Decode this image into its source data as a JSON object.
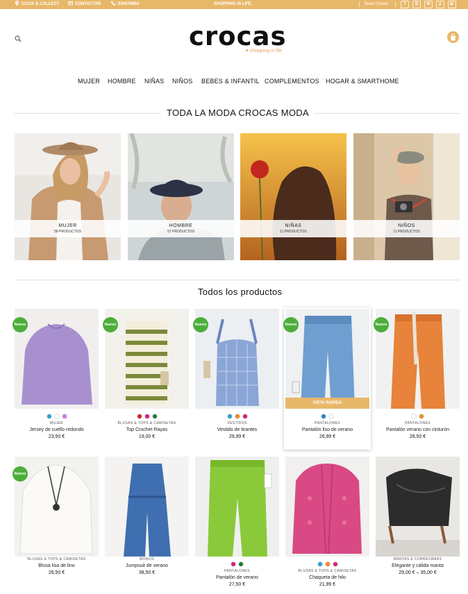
{
  "topbar": {
    "click_collect": "CLICK & COLLECT",
    "contact": "CONTACTAR",
    "phone": "920076894",
    "slogan": "SHOPPING IS LIFE.",
    "team": "Team Crocas"
  },
  "brand": {
    "name": "crocas",
    "tagline": "shopping is life",
    "accent": "#e8b86a"
  },
  "nav": [
    "MUJER",
    "HOMBRE",
    "NIÑAS",
    "NIÑOS",
    "BEBES & INFANTIL",
    "COMPLEMENTOS",
    "HOGAR & SMARTHOME"
  ],
  "categories_title": "TODA LA MODA CROCAS MODA",
  "categories": [
    {
      "name": "MUJER",
      "count": "58 PRODUCTOS"
    },
    {
      "name": "HOMBRE",
      "count": "57 PRODUCTOS"
    },
    {
      "name": "NIÑAS",
      "count": "11 PRODUCTOS"
    },
    {
      "name": "NIÑOS",
      "count": "11 PRODUCTOS"
    }
  ],
  "products_title": "Todos los productos",
  "badge_label": "Nuevo",
  "quick_view_label": "VISTA RÁPIDA",
  "products": [
    {
      "category": "MUJER",
      "name": "Jersey de cuello redondo",
      "price": "23,50 €",
      "is_new": true,
      "swatches": [
        "#2aa3d8",
        "#ffffff",
        "#c77fe0"
      ]
    },
    {
      "category": "BLUSAS & TOPS & CAMISETAS",
      "name": "Top Crochet Rayas",
      "price": "19,00 €",
      "is_new": true,
      "swatches": [
        "#d81f26",
        "#e0187b",
        "#1e7a2a"
      ]
    },
    {
      "category": "VESTIDOS",
      "name": "Vestido de tirantes",
      "price": "29,99 €",
      "is_new": true,
      "swatches": [
        "#2aa3d8",
        "#f08a1c",
        "#e0187b"
      ]
    },
    {
      "category": "PANTALONES",
      "name": "Pantalón liso de verano",
      "price": "26,99 €",
      "is_new": true,
      "swatches": [
        "#2a7fd8",
        "#ffffff"
      ]
    },
    {
      "category": "PANTALONES",
      "name": "Pantalón verano con cinturón",
      "price": "28,50 €",
      "is_new": true,
      "swatches": [
        "#ffffff",
        "#f08a1c"
      ]
    },
    {
      "category": "BLUSAS & TOPS & CAMISETAS",
      "name": "Blusa lisa de lino",
      "price": "26,50 €",
      "is_new": true,
      "swatches": []
    },
    {
      "category": "MONOS",
      "name": "Jumpsuit de verano",
      "price": "38,50 €",
      "is_new": false,
      "swatches": []
    },
    {
      "category": "PANTALONES",
      "name": "Pantalón de verano",
      "price": "27,50 €",
      "is_new": false,
      "swatches": [
        "#e0187b",
        "#1e7a2a"
      ]
    },
    {
      "category": "BLUSAS & TOPS & CAMISETAS",
      "name": "Chaqueta de hilo",
      "price": "21,99 €",
      "is_new": false,
      "swatches": [
        "#2aa3d8",
        "#f08a1c",
        "#e0187b"
      ]
    },
    {
      "category": "MANTAS & CUBRECAMAS",
      "name": "Elegante y cálida manta",
      "price": "29,00 € – 35,00 €",
      "is_new": false,
      "swatches": []
    }
  ]
}
